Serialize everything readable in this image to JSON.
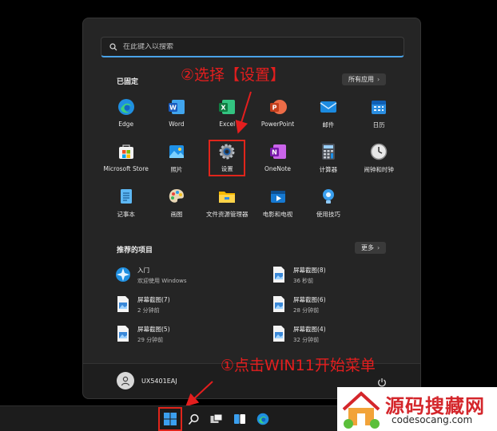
{
  "search": {
    "placeholder": "在此键入以搜索"
  },
  "pinned": {
    "title": "已固定",
    "all_apps_label": "所有应用",
    "apps": [
      {
        "label": "Edge",
        "icon": "edge-icon"
      },
      {
        "label": "Word",
        "icon": "word-icon"
      },
      {
        "label": "Excel",
        "icon": "excel-icon"
      },
      {
        "label": "PowerPoint",
        "icon": "powerpoint-icon"
      },
      {
        "label": "邮件",
        "icon": "mail-icon"
      },
      {
        "label": "日历",
        "icon": "calendar-icon"
      },
      {
        "label": "Microsoft Store",
        "icon": "store-icon"
      },
      {
        "label": "照片",
        "icon": "photos-icon"
      },
      {
        "label": "设置",
        "icon": "settings-gear-icon"
      },
      {
        "label": "OneNote",
        "icon": "onenote-icon"
      },
      {
        "label": "计算器",
        "icon": "calculator-icon"
      },
      {
        "label": "闹钟和时钟",
        "icon": "clock-icon"
      },
      {
        "label": "记事本",
        "icon": "notepad-icon"
      },
      {
        "label": "画图",
        "icon": "paint-icon"
      },
      {
        "label": "文件资源管理器",
        "icon": "folder-icon"
      },
      {
        "label": "电影和电视",
        "icon": "movies-icon"
      },
      {
        "label": "使用技巧",
        "icon": "tips-icon"
      }
    ]
  },
  "recommended": {
    "title": "推荐的项目",
    "more_label": "更多",
    "items": [
      {
        "title": "入门",
        "subtitle": "欢迎使用 Windows",
        "icon": "get-started-icon"
      },
      {
        "title": "屏幕截图(8)",
        "subtitle": "36 秒前",
        "icon": "image-file-icon"
      },
      {
        "title": "屏幕截图(7)",
        "subtitle": "2 分钟前",
        "icon": "image-file-icon"
      },
      {
        "title": "屏幕截图(6)",
        "subtitle": "28 分钟前",
        "icon": "image-file-icon"
      },
      {
        "title": "屏幕截图(5)",
        "subtitle": "29 分钟前",
        "icon": "image-file-icon"
      },
      {
        "title": "屏幕截图(4)",
        "subtitle": "32 分钟前",
        "icon": "image-file-icon"
      }
    ]
  },
  "user": {
    "name": "UX5401EAJ"
  },
  "annotations": {
    "step2": "②选择【设置】",
    "step1": "①点击WIN11开始菜单"
  },
  "watermark": {
    "title": "源码搜藏网",
    "url": "codesocang.com"
  },
  "colors": {
    "accent": "#4aa3e8",
    "annotation": "#e0251b",
    "menu_bg": "#252525"
  }
}
